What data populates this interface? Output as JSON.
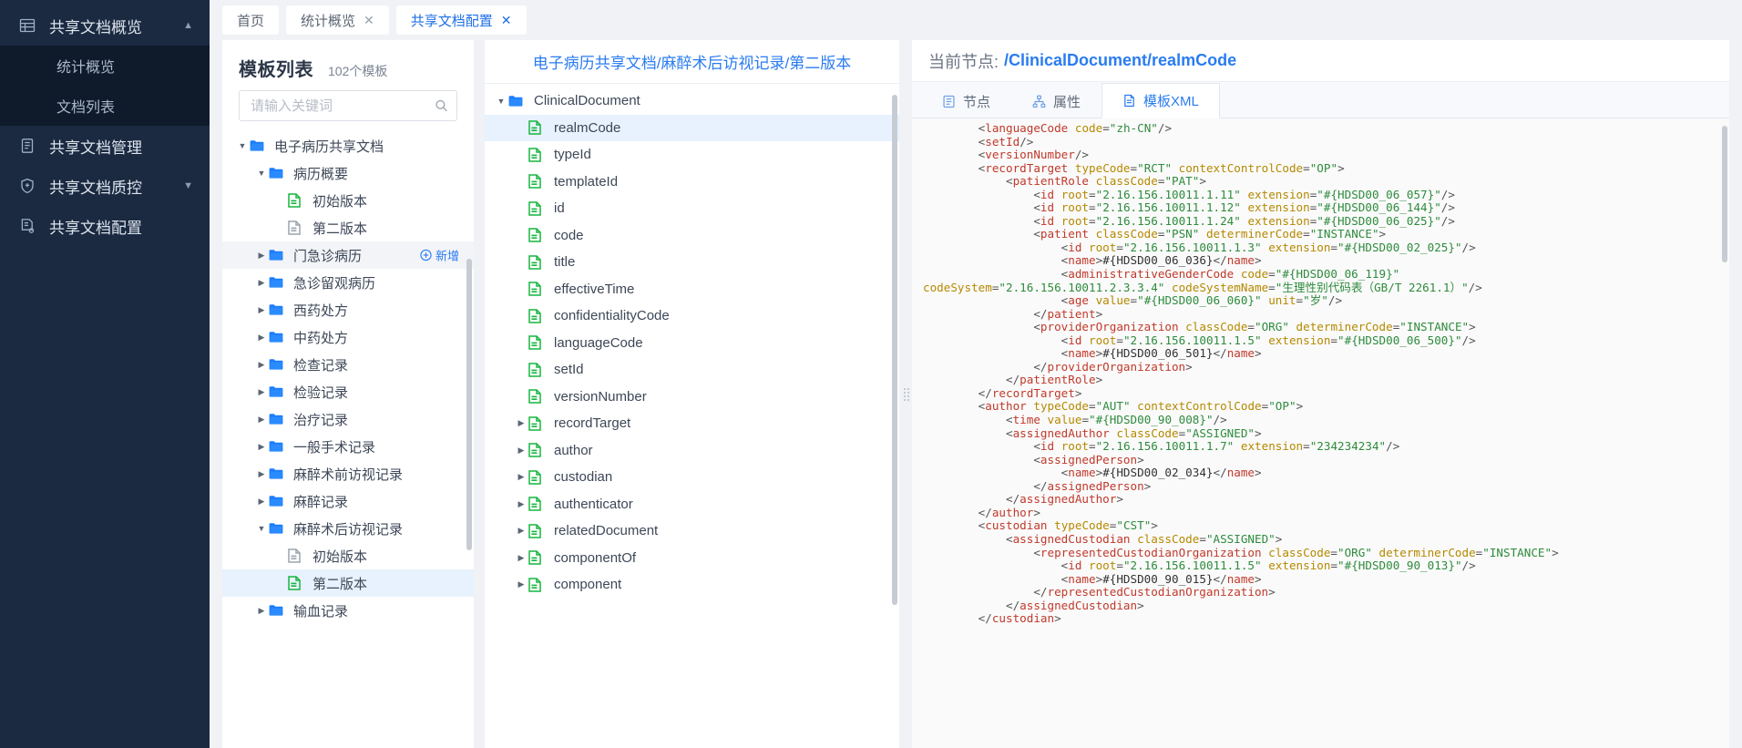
{
  "sidebar": {
    "groups": [
      {
        "label": "共享文档概览",
        "icon": "table-icon",
        "expanded": true,
        "caret": "chevron-up-icon",
        "children": [
          "统计概览",
          "文档列表"
        ]
      },
      {
        "label": "共享文档管理",
        "icon": "document-icon",
        "expanded": false,
        "caret": ""
      },
      {
        "label": "共享文档质控",
        "icon": "shield-plus-icon",
        "expanded": false,
        "caret": "chevron-down-icon"
      },
      {
        "label": "共享文档配置",
        "icon": "document-gear-icon",
        "expanded": false,
        "caret": ""
      }
    ]
  },
  "tabs": [
    {
      "label": "首页",
      "closable": false,
      "active": false
    },
    {
      "label": "统计概览",
      "closable": true,
      "active": false
    },
    {
      "label": "共享文档配置",
      "closable": true,
      "active": true
    }
  ],
  "template_list": {
    "title": "模板列表",
    "count_label": "102个模板",
    "search_placeholder": "请输入关键词",
    "search_value": "",
    "add_label": "新增",
    "tree": [
      {
        "label": "电子病历共享文档",
        "depth": 0,
        "type": "folder",
        "arrow": "down",
        "state": "normal"
      },
      {
        "label": "病历概要",
        "depth": 1,
        "type": "folder",
        "arrow": "down",
        "state": "normal"
      },
      {
        "label": "初始版本",
        "depth": 2,
        "type": "file-green",
        "arrow": "none",
        "state": "normal"
      },
      {
        "label": "第二版本",
        "depth": 2,
        "type": "file-grey",
        "arrow": "none",
        "state": "normal"
      },
      {
        "label": "门急诊病历",
        "depth": 1,
        "type": "folder",
        "arrow": "right",
        "state": "hover",
        "add": true
      },
      {
        "label": "急诊留观病历",
        "depth": 1,
        "type": "folder",
        "arrow": "right",
        "state": "normal"
      },
      {
        "label": "西药处方",
        "depth": 1,
        "type": "folder",
        "arrow": "right",
        "state": "normal"
      },
      {
        "label": "中药处方",
        "depth": 1,
        "type": "folder",
        "arrow": "right",
        "state": "normal"
      },
      {
        "label": "检查记录",
        "depth": 1,
        "type": "folder",
        "arrow": "right",
        "state": "normal"
      },
      {
        "label": "检验记录",
        "depth": 1,
        "type": "folder",
        "arrow": "right",
        "state": "normal"
      },
      {
        "label": "治疗记录",
        "depth": 1,
        "type": "folder",
        "arrow": "right",
        "state": "normal"
      },
      {
        "label": "一般手术记录",
        "depth": 1,
        "type": "folder",
        "arrow": "right",
        "state": "normal"
      },
      {
        "label": "麻醉术前访视记录",
        "depth": 1,
        "type": "folder",
        "arrow": "right",
        "state": "normal"
      },
      {
        "label": "麻醉记录",
        "depth": 1,
        "type": "folder",
        "arrow": "right",
        "state": "normal"
      },
      {
        "label": "麻醉术后访视记录",
        "depth": 1,
        "type": "folder",
        "arrow": "down",
        "state": "normal"
      },
      {
        "label": "初始版本",
        "depth": 2,
        "type": "file-grey",
        "arrow": "none",
        "state": "normal"
      },
      {
        "label": "第二版本",
        "depth": 2,
        "type": "file-green",
        "arrow": "none",
        "state": "selected"
      },
      {
        "label": "输血记录",
        "depth": 1,
        "type": "folder",
        "arrow": "right",
        "state": "normal"
      }
    ]
  },
  "node_panel": {
    "breadcrumb": "电子病历共享文档/麻醉术后访视记录/第二版本",
    "nodes": [
      {
        "label": "ClinicalDocument",
        "depth": 0,
        "arrow": "down",
        "type": "folder",
        "selected": false
      },
      {
        "label": "realmCode",
        "depth": 1,
        "arrow": "none",
        "type": "file-green",
        "selected": true
      },
      {
        "label": "typeId",
        "depth": 1,
        "arrow": "none",
        "type": "file-green",
        "selected": false
      },
      {
        "label": "templateId",
        "depth": 1,
        "arrow": "none",
        "type": "file-green",
        "selected": false
      },
      {
        "label": "id",
        "depth": 1,
        "arrow": "none",
        "type": "file-green",
        "selected": false
      },
      {
        "label": "code",
        "depth": 1,
        "arrow": "none",
        "type": "file-green",
        "selected": false
      },
      {
        "label": "title",
        "depth": 1,
        "arrow": "none",
        "type": "file-green",
        "selected": false
      },
      {
        "label": "effectiveTime",
        "depth": 1,
        "arrow": "none",
        "type": "file-green",
        "selected": false
      },
      {
        "label": "confidentialityCode",
        "depth": 1,
        "arrow": "none",
        "type": "file-green",
        "selected": false
      },
      {
        "label": "languageCode",
        "depth": 1,
        "arrow": "none",
        "type": "file-green",
        "selected": false
      },
      {
        "label": "setId",
        "depth": 1,
        "arrow": "none",
        "type": "file-green",
        "selected": false
      },
      {
        "label": "versionNumber",
        "depth": 1,
        "arrow": "none",
        "type": "file-green",
        "selected": false
      },
      {
        "label": "recordTarget",
        "depth": 1,
        "arrow": "right",
        "type": "file-green",
        "selected": false
      },
      {
        "label": "author",
        "depth": 1,
        "arrow": "right",
        "type": "file-green",
        "selected": false
      },
      {
        "label": "custodian",
        "depth": 1,
        "arrow": "right",
        "type": "file-green",
        "selected": false
      },
      {
        "label": "authenticator",
        "depth": 1,
        "arrow": "right",
        "type": "file-green",
        "selected": false
      },
      {
        "label": "relatedDocument",
        "depth": 1,
        "arrow": "right",
        "type": "file-green",
        "selected": false
      },
      {
        "label": "componentOf",
        "depth": 1,
        "arrow": "right",
        "type": "file-green",
        "selected": false
      },
      {
        "label": "component",
        "depth": 1,
        "arrow": "right",
        "type": "file-green",
        "selected": false
      }
    ]
  },
  "detail": {
    "current_node_label": "当前节点:",
    "current_node_path": "/ClinicalDocument/realmCode",
    "tabs": [
      {
        "label": "节点",
        "icon": "node-list-icon",
        "active": false
      },
      {
        "label": "属性",
        "icon": "sitemap-icon",
        "active": false
      },
      {
        "label": "模板XML",
        "icon": "xml-document-icon",
        "active": true
      }
    ],
    "xml_lines": [
      "        <languageCode code=\"zh-CN\"/>",
      "        <setId/>",
      "        <versionNumber/>",
      "        <recordTarget typeCode=\"RCT\" contextControlCode=\"OP\">",
      "            <patientRole classCode=\"PAT\">",
      "                <id root=\"2.16.156.10011.1.11\" extension=\"#{HDSD00_06_057}\"/>",
      "                <id root=\"2.16.156.10011.1.12\" extension=\"#{HDSD00_06_144}\"/>",
      "                <id root=\"2.16.156.10011.1.24\" extension=\"#{HDSD00_06_025}\"/>",
      "                <patient classCode=\"PSN\" determinerCode=\"INSTANCE\">",
      "                    <id root=\"2.16.156.10011.1.3\" extension=\"#{HDSD00_02_025}\"/>",
      "                    <name>#{HDSD00_06_036}</name>",
      "                    <administrativeGenderCode code=\"#{HDSD00_06_119}\"",
      "codeSystem=\"2.16.156.10011.2.3.3.4\" codeSystemName=\"生理性别代码表（GB/T 2261.1）\"/>",
      "                    <age value=\"#{HDSD00_06_060}\" unit=\"岁\"/>",
      "                </patient>",
      "                <providerOrganization classCode=\"ORG\" determinerCode=\"INSTANCE\">",
      "                    <id root=\"2.16.156.10011.1.5\" extension=\"#{HDSD00_06_500}\"/>",
      "                    <name>#{HDSD00_06_501}</name>",
      "                </providerOrganization>",
      "            </patientRole>",
      "        </recordTarget>",
      "        <author typeCode=\"AUT\" contextControlCode=\"OP\">",
      "            <time value=\"#{HDSD00_90_008}\"/>",
      "            <assignedAuthor classCode=\"ASSIGNED\">",
      "                <id root=\"2.16.156.10011.1.7\" extension=\"234234234\"/>",
      "                <assignedPerson>",
      "                    <name>#{HDSD00_02_034}</name>",
      "                </assignedPerson>",
      "            </assignedAuthor>",
      "        </author>",
      "        <custodian typeCode=\"CST\">",
      "            <assignedCustodian classCode=\"ASSIGNED\">",
      "                <representedCustodianOrganization classCode=\"ORG\" determinerCode=\"INSTANCE\">",
      "                    <id root=\"2.16.156.10011.1.5\" extension=\"#{HDSD00_90_013}\"/>",
      "                    <name>#{HDSD00_90_015}</name>",
      "                </representedCustodianOrganization>",
      "            </assignedCustodian>",
      "        </custodian>"
    ]
  },
  "colors": {
    "accent": "#2a7cf0",
    "sidebar_bg": "#1b2a41",
    "sidebar_sub_bg": "#0f1a2b",
    "folder": "#1d7dfc",
    "file_green": "#17b53f",
    "file_grey": "#9aa3ae",
    "xml_tag": "#c0392b",
    "xml_attr": "#b58900",
    "xml_value": "#2e8b3d"
  }
}
